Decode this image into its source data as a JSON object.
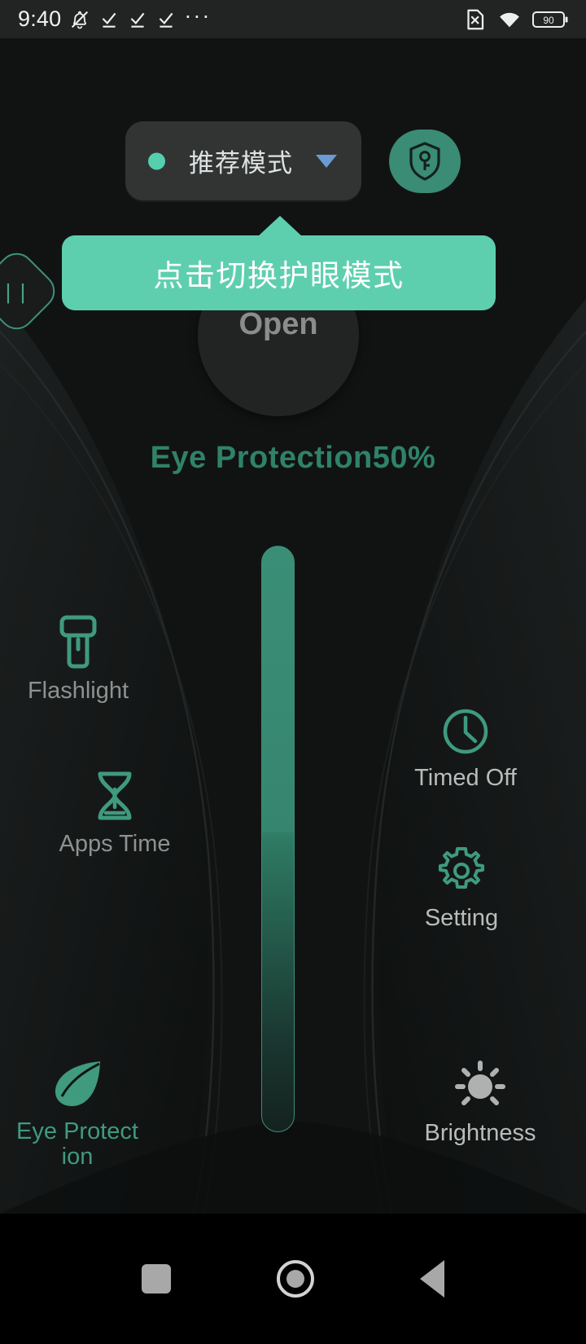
{
  "status_bar": {
    "time": "9:40",
    "icons_left": [
      "silent-mode-icon",
      "task-done-icon",
      "task-done-icon",
      "task-done-icon"
    ],
    "overflow": "···",
    "icons_right": [
      "no-sim-icon",
      "wifi-icon"
    ],
    "battery_level": "90"
  },
  "mode_selector": {
    "label": "推荐模式",
    "dot_color": "#56ceae",
    "caret_color": "#6c9ad4",
    "shield_icon": "shield-key-icon",
    "shield_bg": "#3a8c74"
  },
  "tooltip": {
    "text": "点击切换护眼模式",
    "bg": "#5ecfae",
    "fg": "#ffffff"
  },
  "power_circle": {
    "label": "Open"
  },
  "eye_protection": {
    "readout": "Eye Protection50%",
    "percent": 50,
    "color": "#2f8268"
  },
  "slider": {
    "value_percent": 50,
    "handle_icon": "pause-grip-icon",
    "handle_glyph": "| |",
    "track_color": "#3b8e76"
  },
  "items": {
    "flashlight": {
      "label": "Flashlight",
      "icon": "flashlight-icon",
      "label_color": "#8d9190"
    },
    "apps_time": {
      "label": "Apps Time",
      "icon": "hourglass-icon",
      "label_color": "#8d9190"
    },
    "eye_protect": {
      "label": "Eye Protection",
      "icon": "leaf-icon",
      "label_color": "#3f9a7e"
    },
    "timed_off": {
      "label": "Timed Off",
      "icon": "clock-icon",
      "label_color": "#b9bcbb"
    },
    "setting": {
      "label": "Setting",
      "icon": "gear-icon",
      "label_color": "#b9bcbb"
    },
    "brightness": {
      "label": "Brightness",
      "icon": "sun-brightness-icon",
      "label_color": "#b9bcbb"
    }
  },
  "nav_bar": {
    "recents": "recents-square-icon",
    "home": "home-circle-icon",
    "back": "back-triangle-icon"
  },
  "colors": {
    "accent": "#3f9a7e",
    "accent_light": "#5ecfae",
    "background": "#111313",
    "panel": "#323434"
  }
}
